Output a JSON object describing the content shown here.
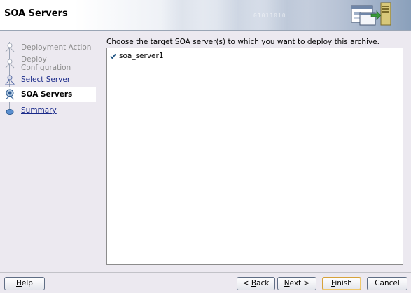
{
  "header": {
    "title": "SOA Servers",
    "decoration_digits": "01011010",
    "icon": "deploy-server-icon"
  },
  "nav": {
    "items": [
      {
        "label": "Deployment Action",
        "state": "done"
      },
      {
        "label": "Deploy Configuration",
        "state": "done"
      },
      {
        "label": "Select Server",
        "state": "link"
      },
      {
        "label": "SOA Servers",
        "state": "current"
      },
      {
        "label": "Summary",
        "state": "link"
      }
    ]
  },
  "content": {
    "instructions": "Choose the target SOA server(s) to which you want to deploy this archive.",
    "servers": [
      {
        "name": "soa_server1",
        "checked": true
      }
    ]
  },
  "footer": {
    "help": {
      "mnemonic": "H",
      "rest": "elp"
    },
    "back": {
      "prefix": "< ",
      "mnemonic": "B",
      "rest": "ack"
    },
    "next": {
      "mnemonic": "N",
      "rest": "ext >"
    },
    "finish": {
      "mnemonic": "F",
      "rest": "inish"
    },
    "cancel": "Cancel"
  },
  "colors": {
    "link": "#1a2a8a",
    "disabled": "#8b8b8b",
    "check": "#1c5180",
    "finish_border": "#d6a23b"
  }
}
